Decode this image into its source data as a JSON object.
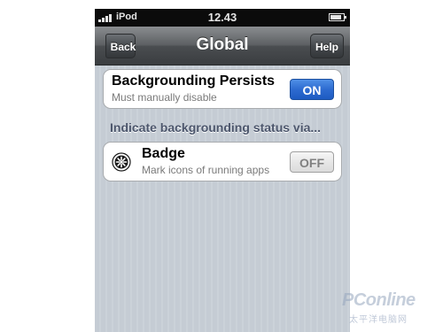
{
  "status_bar": {
    "carrier": "iPod",
    "time": "12.43",
    "battery_level": 0.85
  },
  "nav_bar": {
    "title": "Global",
    "back_label": "Back",
    "help_label": "Help"
  },
  "backgrounding_persists": {
    "title": "Backgrounding Persists",
    "subtitle": "Must manually disable",
    "switch_label": "ON",
    "switch_state": true
  },
  "section": {
    "header": "Indicate backgrounding status via..."
  },
  "badge": {
    "title": "Badge",
    "subtitle": "Mark icons of running apps",
    "switch_label": "OFF",
    "switch_state": false,
    "icon": "badge-gear-icon"
  },
  "watermark": {
    "brand": "PConline",
    "tagline": "太平洋电脑网"
  },
  "colors": {
    "switch_on": "#2d6bd0",
    "nav_bar": "#4a4d50",
    "section_header": "#4c566c",
    "background": "#c5ccd4"
  }
}
